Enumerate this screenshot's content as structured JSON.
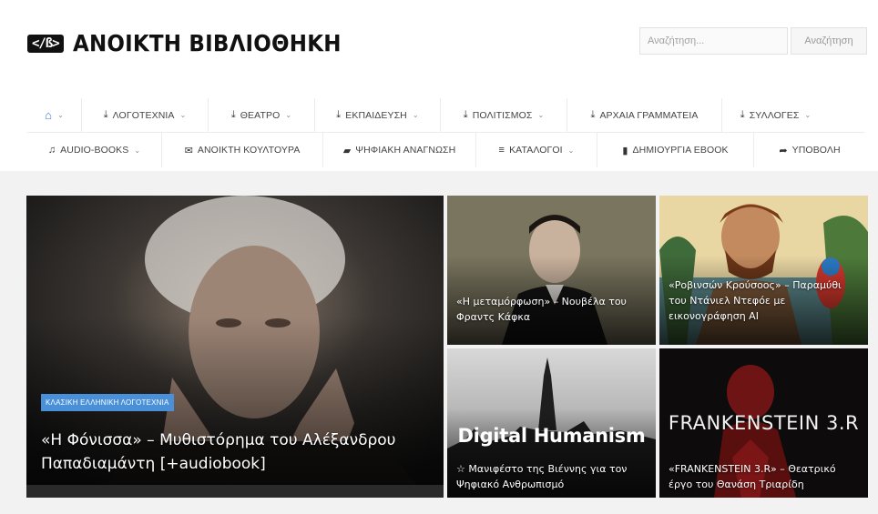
{
  "header": {
    "logo_badge": "</ß>",
    "site_title": "ΑΝΟΙΚΤΗ ΒΙΒΛΙΟΘΗΚΗ",
    "search_placeholder": "Αναζήτηση...",
    "search_button": "Αναζήτηση"
  },
  "nav": {
    "row1": [
      {
        "icon": "home-icon",
        "label": ""
      },
      {
        "icon": "download-icon",
        "label": "ΛΟΓΟΤΕΧΝΙΑ"
      },
      {
        "icon": "download-icon",
        "label": "ΘΕΑΤΡΟ"
      },
      {
        "icon": "download-icon",
        "label": "ΕΚΠΑΙΔΕΥΣΗ"
      },
      {
        "icon": "download-icon",
        "label": "ΠΟΛΙΤΙΣΜΟΣ"
      },
      {
        "icon": "download-icon",
        "label": "ΑΡΧΑΙΑ ΓΡΑΜΜΑΤΕΙΑ"
      },
      {
        "icon": "download-icon",
        "label": "ΣΥΛΛΟΓΕΣ"
      }
    ],
    "row2": [
      {
        "icon": "headphones-icon",
        "label": "AUDIO-BOOKS"
      },
      {
        "icon": "chat-icon",
        "label": "ΑΝΟΙΚΤΗ ΚΟΥΛΤΟΥΡΑ"
      },
      {
        "icon": "book-icon",
        "label": "ΨΗΦΙΑΚΗ ΑΝΑΓΝΩΣΗ"
      },
      {
        "icon": "list-icon",
        "label": "ΚΑΤΑΛΟΓΟΙ"
      },
      {
        "icon": "file-icon",
        "label": "ΔΗΜΙΟΥΡΓΙΑ EBOOK"
      },
      {
        "icon": "share-icon",
        "label": "ΥΠΟΒΟΛΗ"
      }
    ]
  },
  "featured": {
    "main": {
      "category": "ΚΛΑΣΙΚΗ ΕΛΛΗΝΙΚΗ ΛΟΓΟΤΕΧΝΙΑ",
      "title": "«Η Φόνισσα» – Μυθιστόρημα του Αλέξανδρου Παπαδιαμάντη [+audiobook]"
    },
    "tiles": [
      {
        "title": "«Η μεταμόρφωση» – Νουβέλα του Φραντς Κάφκα"
      },
      {
        "title": "«Ροβινσών Κρούσοος» – Παραμύθι του Ντάνιελ Ντεφόε με εικονογράφηση AI"
      },
      {
        "title": "☆ Μανιφέστο της Βιέννης για τον Ψηφιακό Ανθρωπισμό",
        "image_text": "Digital Humanism"
      },
      {
        "title": "«FRANKENSTEIN 3.R» – Θεατρικό έργο του Θανάση Τριαρίδη",
        "image_text": "FRANKENSTEIN 3.R"
      }
    ]
  },
  "colors": {
    "accent": "#4a90d9",
    "background_band": "#f2f2f2"
  }
}
